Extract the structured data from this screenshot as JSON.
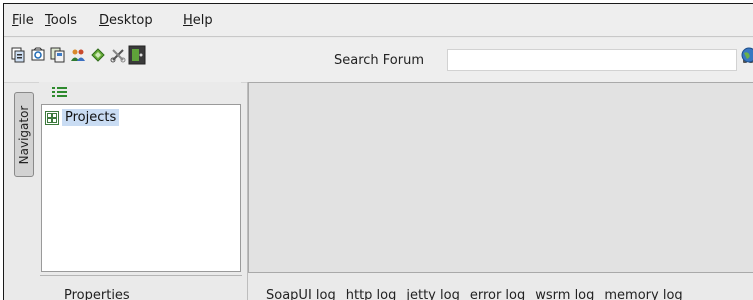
{
  "menu": [
    {
      "label": "File",
      "mnemonic": "F"
    },
    {
      "label": "Tools",
      "mnemonic": "T"
    },
    {
      "label": "Desktop",
      "mnemonic": "D"
    },
    {
      "label": "Help",
      "mnemonic": "H"
    }
  ],
  "toolbar": {
    "icons": [
      "new-project-icon",
      "import-project-icon",
      "save-all-icon",
      "preferences-icon",
      "refresh-icon",
      "tools-icon",
      "exit-icon"
    ],
    "search_label": "Search Forum",
    "search_value": "",
    "right_icons": [
      "binoculars-icon",
      "globe-icon"
    ]
  },
  "navigator": {
    "tab_label": "Navigator"
  },
  "tree": {
    "root_label": "Projects"
  },
  "properties_label": "Properties",
  "log_tabs": [
    "SoapUI log",
    "http log",
    "jetty log",
    "error log",
    "wsrm log",
    "memory log"
  ],
  "colors": {
    "selection": "#c9dcf3",
    "panel": "#e2e2e2",
    "chrome": "#eeeeee"
  }
}
